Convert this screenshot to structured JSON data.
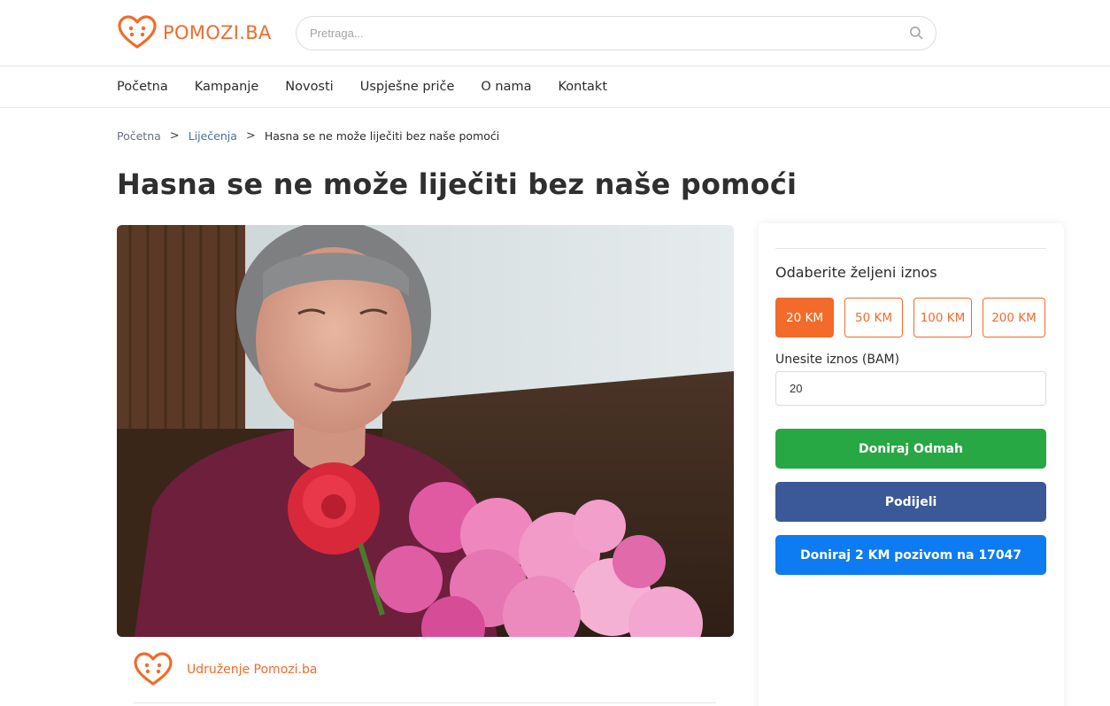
{
  "header": {
    "logo_text": "POMOZI.BA",
    "search_placeholder": "Pretraga..."
  },
  "nav": {
    "items": [
      {
        "label": "Početna"
      },
      {
        "label": "Kampanje"
      },
      {
        "label": "Novosti"
      },
      {
        "label": "Uspješne priče"
      },
      {
        "label": "O nama"
      },
      {
        "label": "Kontakt"
      }
    ]
  },
  "breadcrumb": {
    "home": "Početna",
    "category": "Liječenja",
    "current": "Hasna se ne može liječiti bez naše pomoći",
    "separator": ">"
  },
  "campaign": {
    "title": "Hasna se ne može liječiti bez naše pomoći",
    "organizer": "Udruženje Pomozi.ba"
  },
  "donate": {
    "choose_label": "Odaberite željeni iznos",
    "amounts": [
      "20 KM",
      "50 KM",
      "100 KM",
      "200 KM"
    ],
    "selected_amount": "20 KM",
    "input_label": "Unesite iznos (BAM)",
    "input_value": "20",
    "donate_button": "Doniraj Odmah",
    "share_button": "Podijeli",
    "sms_button": "Doniraj 2 KM pozivom na 17047"
  },
  "colors": {
    "brand_orange": "#f26b2a",
    "donate_green": "#28a745",
    "share_blue": "#3b5998",
    "sms_blue": "#0d7bf2"
  },
  "icons": {
    "logo": "heart-face-icon",
    "search": "search-icon"
  }
}
